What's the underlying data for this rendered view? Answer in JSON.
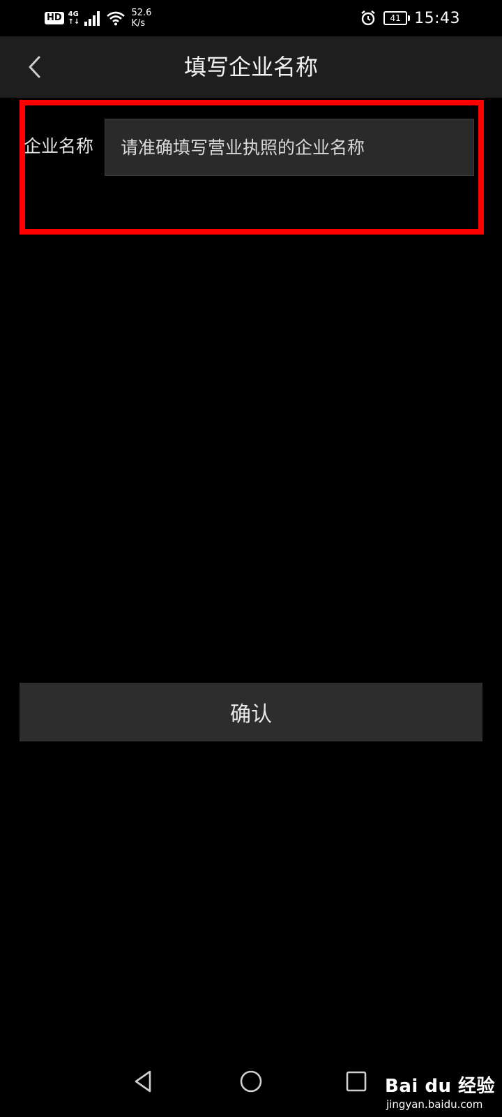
{
  "status_bar": {
    "hd": "HD",
    "network": "4G",
    "net_sub": "↑↓",
    "speed_value": "52.6",
    "speed_unit": "K/s",
    "battery": "41",
    "time": "15:43"
  },
  "header": {
    "title": "填写企业名称",
    "back_icon": "chevron-left-icon"
  },
  "form": {
    "label": "企业名称",
    "value": "",
    "placeholder": "请准确填写营业执照的企业名称",
    "highlight_color": "#ff0000"
  },
  "confirm": {
    "label": "确认"
  },
  "nav_bar": {
    "icons": [
      "back-triangle-icon",
      "home-circle-icon",
      "recents-square-icon"
    ]
  },
  "watermark": {
    "brand": "Bai du 经验",
    "url": "jingyan.baidu.com"
  }
}
